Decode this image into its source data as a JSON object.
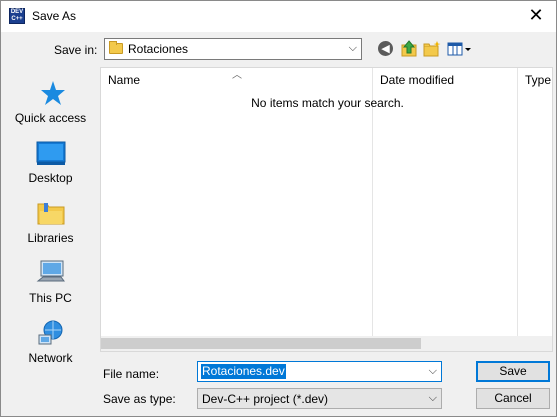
{
  "window": {
    "title": "Save As",
    "close_glyph": "✕",
    "icon_text": [
      "DEV",
      "C++"
    ]
  },
  "toolbar": {
    "save_in_label": "Save in:",
    "save_in_value": "Rotaciones",
    "icons": [
      "back-icon",
      "up-folder-icon",
      "new-folder-icon",
      "view-menu-icon"
    ]
  },
  "places": [
    {
      "label": "Quick access",
      "icon": "star-icon"
    },
    {
      "label": "Desktop",
      "icon": "desktop-icon"
    },
    {
      "label": "Libraries",
      "icon": "libraries-icon"
    },
    {
      "label": "This PC",
      "icon": "computer-icon"
    },
    {
      "label": "Network",
      "icon": "network-icon"
    }
  ],
  "list": {
    "columns": [
      "Name",
      "Date modified",
      "Type"
    ],
    "empty_message": "No items match your search."
  },
  "form": {
    "file_name_label": "File name:",
    "file_name_value": "Rotaciones.dev",
    "save_as_type_label": "Save as type:",
    "save_as_type_value": "Dev-C++ project (*.dev)",
    "save_button": "Save",
    "cancel_button": "Cancel"
  },
  "colors": {
    "accent": "#0078d7",
    "folder": "#f3c94b"
  }
}
